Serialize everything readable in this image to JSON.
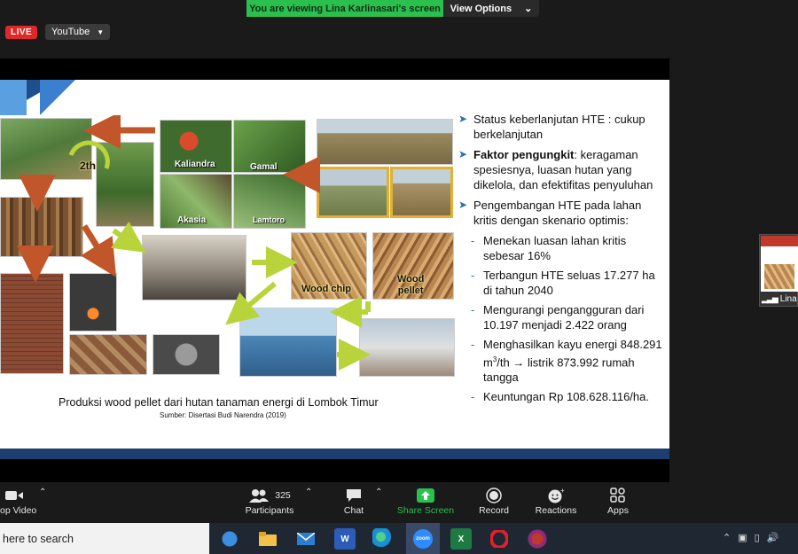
{
  "banner": {
    "viewing_text": "You are viewing Lina Karlinasari's screen",
    "view_options": "View Options"
  },
  "stream": {
    "live_label": "LIVE",
    "platform_label": "YouTube"
  },
  "slide": {
    "photo_labels": {
      "rotation": "2th",
      "kaliandra": "Kaliandra",
      "gamal": "Gamal",
      "akasia": "Akasia",
      "lamtoro": "Lamtoro",
      "wood_chip": "Wood chip",
      "wood_pellet": "Wood\npellet"
    },
    "caption": "Produksi wood pellet dari hutan tanaman energi di Lombok Timur",
    "source": "Sumber: Disertasi Budi Narendra (2019)",
    "bullets": {
      "b1": "Status keberlanjutan HTE : cukup berkelanjutan",
      "b2_bold": "Faktor pengungkit",
      "b2_rest": ": keragaman spesiesnya, luasan hutan yang dikelola, dan efektifitas penyuluhan",
      "b3": "Pengembangan HTE pada lahan kritis dengan skenario optimis:",
      "s1": "Menekan luasan lahan kritis sebesar 16%",
      "s2": "Terbangun HTE seluas 17.277 ha di tahun 2040",
      "s3": "Mengurangi pengangguran dari 10.197 menjadi 2.422 orang",
      "s4a": "Menghasilkan kayu energi 848.291 m",
      "s4sup": "3",
      "s4b": "/th → listrik 873.992 rumah tangga",
      "s5": "Keuntungan Rp 108.628.116/ha."
    }
  },
  "participant_thumb": {
    "name": "Lina"
  },
  "toolbar": {
    "video": "op Video",
    "participants": "Participants",
    "participant_count": "325",
    "chat": "Chat",
    "share": "Share Screen",
    "record": "Record",
    "reactions": "Reactions",
    "apps": "Apps"
  },
  "taskbar": {
    "search_placeholder": "here to search",
    "apps": [
      "Windows Security",
      "File Explorer",
      "Mail",
      "Word",
      "Edge",
      "Zoom",
      "Excel",
      "Opera",
      "Firefox"
    ]
  },
  "colors": {
    "share_green": "#2bbf4e",
    "live_red": "#e02828",
    "slide_blue": "#1d3e6e",
    "bullet_blue": "#2a6fb5"
  }
}
